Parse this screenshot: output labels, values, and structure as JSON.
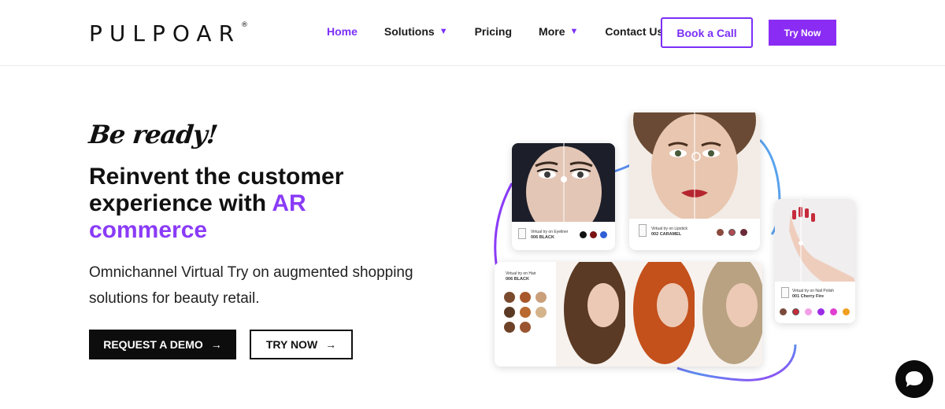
{
  "header": {
    "logo": "PULPOAR",
    "logo_mark": "®",
    "nav": [
      {
        "label": "Home",
        "active": true,
        "dropdown": false
      },
      {
        "label": "Solutions",
        "active": false,
        "dropdown": true
      },
      {
        "label": "Pricing",
        "active": false,
        "dropdown": false
      },
      {
        "label": "More",
        "active": false,
        "dropdown": true
      },
      {
        "label": "Contact Us",
        "active": false,
        "dropdown": false
      }
    ],
    "book_call_label": "Book a Call",
    "try_now_label": "Try Now"
  },
  "hero": {
    "tagline": "Be ready!",
    "headline_part1": "Reinvent the customer experience with ",
    "headline_accent": "AR commerce",
    "subtitle": "Omnichannel Virtual Try on augmented shopping solutions for beauty retail.",
    "demo_button": "REQUEST A DEMO",
    "trynow_button": "TRY NOW"
  },
  "collage": {
    "eyeliner": {
      "caption": "Virtual try on Eyeliner",
      "shade": "006 BLACK"
    },
    "lipstick": {
      "caption": "Virtual try on Lipstick",
      "shade": "002 CARAMEL"
    },
    "nail": {
      "caption": "Virtual try on Nail Polish",
      "shade": "001 Cherry Fire"
    },
    "hair": {
      "caption": "Virtual try on Hair",
      "shade": "006 BLACK"
    }
  },
  "colors": {
    "accent": "#7b2ff7",
    "dark": "#0d0d0d"
  },
  "icons": {
    "caret": "▼",
    "arrow": "→",
    "chat": "chat-bubble-icon"
  }
}
